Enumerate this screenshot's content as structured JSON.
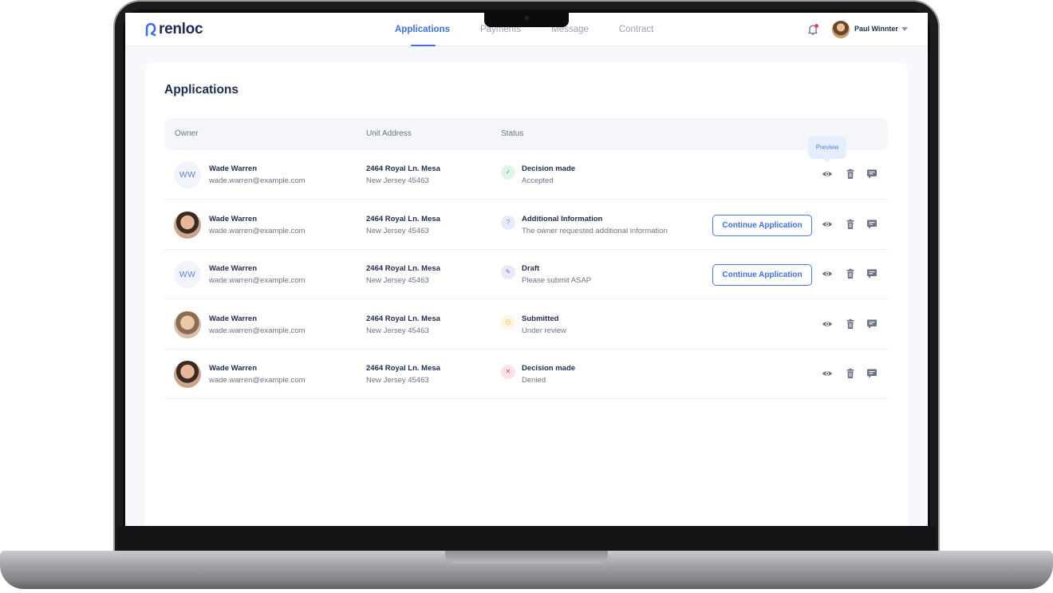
{
  "brand": {
    "name": "renloc",
    "accent": "#3f6fe0"
  },
  "nav": [
    {
      "label": "Applications",
      "active": true
    },
    {
      "label": "Payments",
      "active": false
    },
    {
      "label": "Message",
      "active": false
    },
    {
      "label": "Contract",
      "active": false
    }
  ],
  "user": {
    "name": "Paul Winnter",
    "has_notification": true
  },
  "page": {
    "title": "Applications"
  },
  "table": {
    "headers": {
      "owner": "Owner",
      "address": "Unit Address",
      "status": "Status"
    },
    "tooltip": "Preview",
    "rows": [
      {
        "avatar": "initials",
        "initials": "WW",
        "name": "Wade Warren",
        "email": "wade.warren@example.com",
        "addr1": "2464 Royal Ln. Mesa",
        "addr2": "New Jersey 45463",
        "status_icon": "check-icon",
        "status_color": "#3cb371",
        "status_title": "Decision made",
        "status_sub": "Accepted",
        "action": ""
      },
      {
        "avatar": "photo",
        "initials": "",
        "name": "Wade Warren",
        "email": "wade.warren@example.com",
        "addr1": "2464 Royal Ln. Mesa",
        "addr2": "New Jersey 45463",
        "status_icon": "question-icon",
        "status_color": "#5a7fd6",
        "status_title": "Additional Information",
        "status_sub": "The owner requested additional information",
        "action": "Continue Application"
      },
      {
        "avatar": "initials",
        "initials": "WW",
        "name": "Wade Warren",
        "email": "wade.warren@example.com",
        "addr1": "2464 Royal Ln. Mesa",
        "addr2": "New Jersey 45463",
        "status_icon": "pencil-icon",
        "status_color": "#7a6bd6",
        "status_title": "Draft",
        "status_sub": "Please submit ASAP",
        "action": "Continue Application"
      },
      {
        "avatar": "photo",
        "initials": "",
        "name": "Wade Warren",
        "email": "wade.warren@example.com",
        "addr1": "2464 Royal Ln. Mesa",
        "addr2": "New Jersey 45463",
        "status_icon": "clock-icon",
        "status_color": "#f0b43c",
        "status_title": "Submitted",
        "status_sub": "Under review",
        "action": ""
      },
      {
        "avatar": "photo",
        "initials": "",
        "name": "Wade Warren",
        "email": "wade.warren@example.com",
        "addr1": "2464 Royal Ln. Mesa",
        "addr2": "New Jersey 45463",
        "status_icon": "x-icon",
        "status_color": "#e8435f",
        "status_title": "Decision made",
        "status_sub": "Denied",
        "action": ""
      }
    ]
  }
}
